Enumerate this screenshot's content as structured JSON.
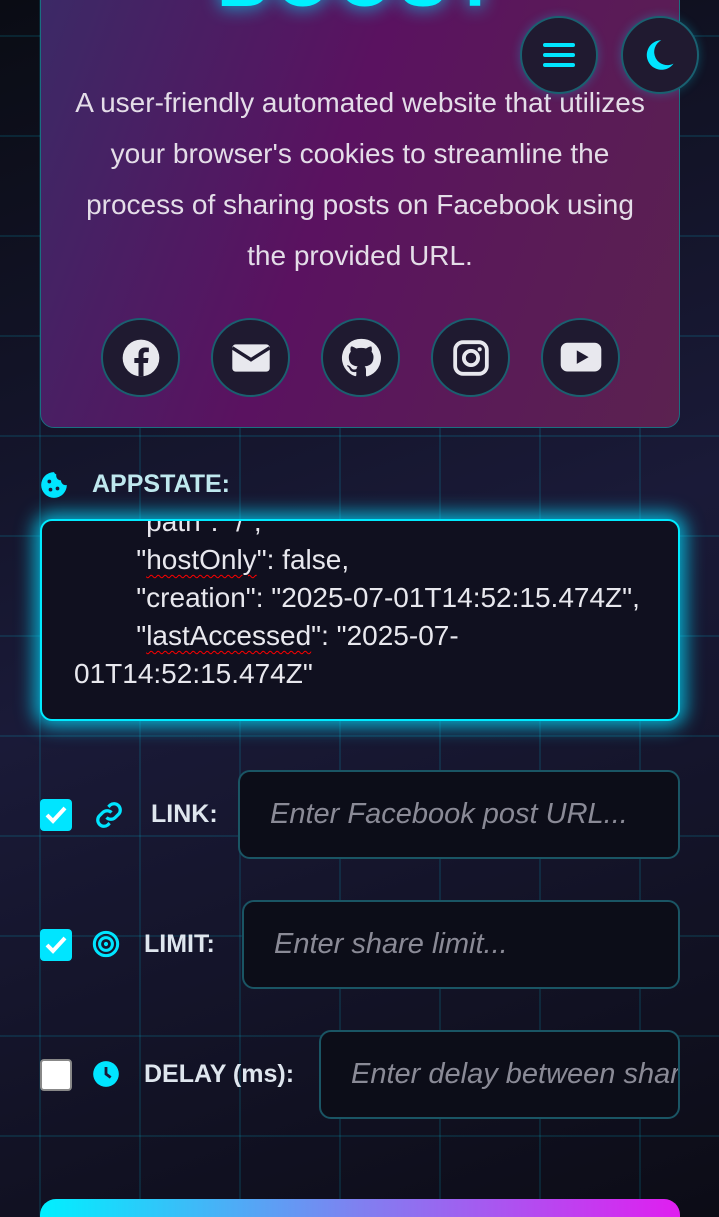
{
  "hero": {
    "title": "BOOST",
    "description": "A user-friendly automated website that utilizes your browser's cookies to streamline the process of sharing posts on Facebook using the provided URL."
  },
  "header": {
    "menu_icon": "hamburger-icon",
    "theme_icon": "moon-icon"
  },
  "socials": [
    {
      "name": "facebook-icon"
    },
    {
      "name": "envelope-icon"
    },
    {
      "name": "github-icon"
    },
    {
      "name": "instagram-icon"
    },
    {
      "name": "youtube-icon"
    }
  ],
  "appstate": {
    "label": "APPSTATE:",
    "icon": "cookie-icon",
    "lines": [
      "        \"path\": \"/\",",
      "        \"hostOnly\": false,",
      "        \"creation\": \"2025-07-01T14:52:15.474Z\",",
      "        \"lastAccessed\": \"2025-07-01T14:52:15.474Z\""
    ]
  },
  "fields": {
    "link": {
      "label": "LINK:",
      "placeholder": "Enter Facebook post URL...",
      "checked": true,
      "icon": "link-icon"
    },
    "limit": {
      "label": "LIMIT:",
      "placeholder": "Enter share limit...",
      "checked": true,
      "icon": "target-icon"
    },
    "delay": {
      "label": "DELAY (ms):",
      "placeholder": "Enter delay between shares...",
      "checked": false,
      "icon": "clock-icon"
    }
  },
  "colors": {
    "accent": "#00e5ff",
    "magenta": "#e01ef0"
  }
}
